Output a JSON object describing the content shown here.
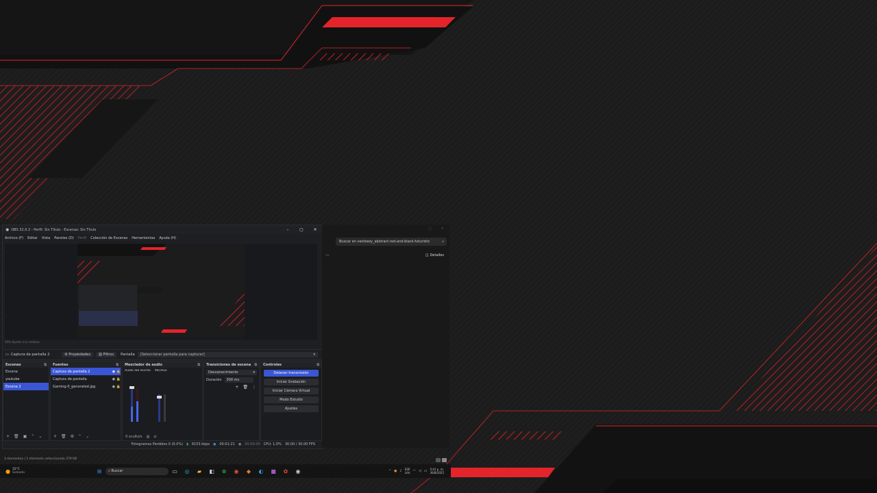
{
  "wallpaper": {
    "accent": "#e3242b",
    "base": "#1b1b1b"
  },
  "obs": {
    "title": "OBS 32.0.2 - Perfil: Sin Título - Escenas: Sin Título",
    "window_buttons": [
      "–",
      "▢",
      "✕"
    ],
    "menu": [
      "Archivo (F)",
      "Editar",
      "Vista",
      "Paneles (D)",
      "Perfil",
      "Colección de Escenas",
      "Herramientas",
      "Ayuda (H)"
    ],
    "zoom_row": "50%     Ajustar a la ventana",
    "source_bar": {
      "current_source": "Captura de pantalla 2",
      "properties": "Propiedades",
      "filters": "Filtros",
      "screen_label": "Pantalla",
      "screen_value": "[Seleccionar pantalla para capturar]"
    },
    "scenes": {
      "header": "Escenas",
      "items": [
        "Escena",
        "youtube",
        "Escena 2"
      ],
      "selected_index": 2
    },
    "sources": {
      "header": "Fuentes",
      "items": [
        "Captura de pantalla 2",
        "Captura de pantalla",
        "Gaming-0_generated.jpg"
      ],
      "selected_index": 0
    },
    "mixer": {
      "header": "Mezclador de audio",
      "channels": [
        "Audio del escritorio",
        "Mic/Aux"
      ],
      "hidden_label": "0 oculto/s",
      "options_label": "Opciones"
    },
    "transitions": {
      "header": "Transiciones de escena",
      "type": "Desvanecimiento",
      "duration_label": "Duración",
      "duration_value": "300 ms"
    },
    "controls": {
      "header": "Controles",
      "buttons": [
        "Detener transmisión",
        "Iniciar Grabación",
        "Iniciar Cámara Virtual",
        "Modo Estudio",
        "Ajustes"
      ]
    },
    "status": {
      "dropped": "Fotogramas Perdidos 0 (0.0%)",
      "bitrate": "6153 kbps",
      "live_time": "00:01:21",
      "rec_time": "00:00:00",
      "cpu": "CPU: 1.0%",
      "fps": "30.00 / 30.00 FPS"
    }
  },
  "explorer": {
    "search_placeholder": "Buscar en vecteezy_abstract-red-and-black-futuristic",
    "details_label": "Detalles",
    "more_label": "···"
  },
  "bottom_status": "3 elementos  |  1 elemento seleccionado  379 KB",
  "taskbar": {
    "weather_temp": "32°C",
    "weather_desc": "Soleado",
    "search_label": "Buscar",
    "lang": "ESP",
    "lang2": "LAA",
    "time": "5:41 p. m.",
    "date": "30/8/2025"
  }
}
